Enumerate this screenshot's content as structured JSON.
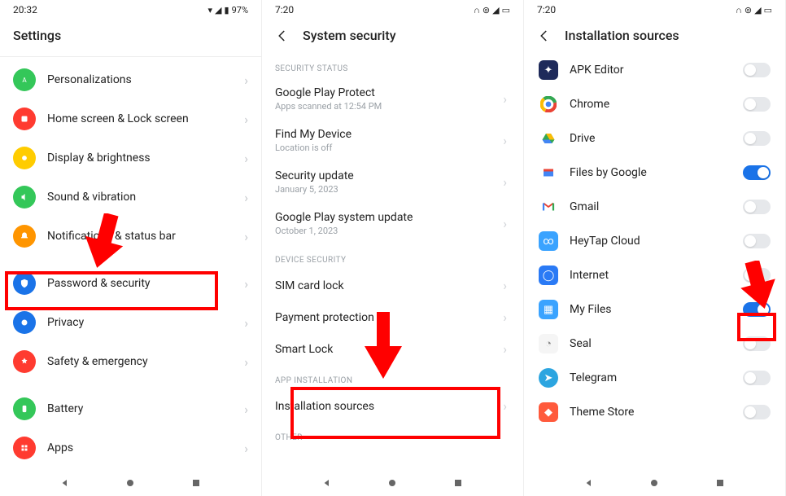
{
  "screen1": {
    "time": "20:32",
    "battery": "97%",
    "title": "Settings",
    "items": [
      {
        "label": "Personalizations",
        "color": "#34c759",
        "glyph": "A"
      },
      {
        "label": "Home screen & Lock screen",
        "color": "#ff3b30",
        "glyph": "grid"
      },
      {
        "label": "Display & brightness",
        "color": "#ffcc00",
        "glyph": "sun"
      },
      {
        "label": "Sound & vibration",
        "color": "#34c759",
        "glyph": "sound"
      },
      {
        "label": "Notifications & status bar",
        "color": "#ff9500",
        "glyph": "bell"
      },
      {
        "label": "Password & security",
        "color": "#1a73e8",
        "glyph": "shield"
      },
      {
        "label": "Privacy",
        "color": "#1a73e8",
        "glyph": "privacy"
      },
      {
        "label": "Safety & emergency",
        "color": "#ff3b30",
        "glyph": "sos"
      },
      {
        "label": "Battery",
        "color": "#34c759",
        "glyph": "battery"
      },
      {
        "label": "Apps",
        "color": "#ff3b30",
        "glyph": "apps"
      }
    ]
  },
  "screen2": {
    "time": "7:20",
    "title": "System security",
    "sections": {
      "status": "SECURITY STATUS",
      "device": "DEVICE SECURITY",
      "app": "APP INSTALLATION",
      "other": "OTHER"
    },
    "rows": {
      "gpp": {
        "label": "Google Play Protect",
        "sub": "Apps scanned at 12:54 PM"
      },
      "fmd": {
        "label": "Find My Device",
        "sub": "Location is off"
      },
      "su": {
        "label": "Security update",
        "sub": "January 5, 2023"
      },
      "gpsu": {
        "label": "Google Play system update",
        "sub": "October 1, 2023"
      },
      "sim": {
        "label": "SIM card lock"
      },
      "pay": {
        "label": "Payment protection"
      },
      "sl": {
        "label": "Smart Lock"
      },
      "inst": {
        "label": "Installation sources"
      }
    }
  },
  "screen3": {
    "time": "7:20",
    "title": "Installation sources",
    "apps": [
      {
        "label": "APK Editor",
        "on": false,
        "bg": "#1e2a5a"
      },
      {
        "label": "Chrome",
        "on": false,
        "bg": "#fff"
      },
      {
        "label": "Drive",
        "on": false,
        "bg": "#fff"
      },
      {
        "label": "Files by Google",
        "on": true,
        "bg": "#fff"
      },
      {
        "label": "Gmail",
        "on": false,
        "bg": "#fff"
      },
      {
        "label": "HeyTap Cloud",
        "on": false,
        "bg": "#3aa3ff"
      },
      {
        "label": "Internet",
        "on": false,
        "bg": "#2a7af5"
      },
      {
        "label": "My Files",
        "on": true,
        "bg": "#3aa3ff"
      },
      {
        "label": "Seal",
        "on": false,
        "bg": "#f5f5f5"
      },
      {
        "label": "Telegram",
        "on": false,
        "bg": "#2ca5e0"
      },
      {
        "label": "Theme Store",
        "on": false,
        "bg": "#ff5a3c"
      }
    ]
  }
}
